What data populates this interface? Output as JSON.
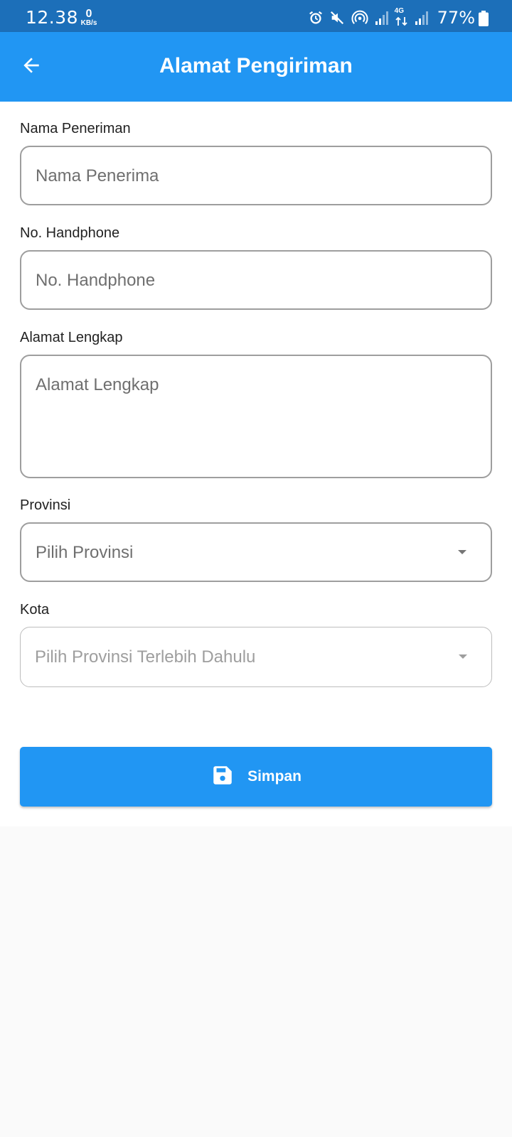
{
  "status_bar": {
    "time": "12.38",
    "net_speed_value": "0",
    "net_speed_unit": "KB/s",
    "network_type": "4G",
    "battery_percent": "77%",
    "icons": [
      "alarm-icon",
      "mute-icon",
      "hotspot-icon",
      "signal-icon",
      "data-arrows-icon",
      "signal-icon",
      "battery-icon"
    ]
  },
  "app_bar": {
    "title": "Alamat Pengiriman",
    "back_icon": "arrow-left-icon",
    "color": "#2196f3"
  },
  "form": {
    "recipient_name": {
      "label": "Nama Peneriman",
      "placeholder": "Nama Penerima",
      "value": ""
    },
    "phone": {
      "label": "No. Handphone",
      "placeholder": "No. Handphone",
      "value": ""
    },
    "address": {
      "label": "Alamat Lengkap",
      "placeholder": "Alamat Lengkap",
      "value": ""
    },
    "province": {
      "label": "Provinsi",
      "selected": "Pilih Provinsi"
    },
    "city": {
      "label": "Kota",
      "selected": "Pilih Provinsi Terlebih Dahulu",
      "disabled": true
    }
  },
  "save_button": {
    "label": "Simpan",
    "icon": "save-icon",
    "color": "#2196f3"
  }
}
